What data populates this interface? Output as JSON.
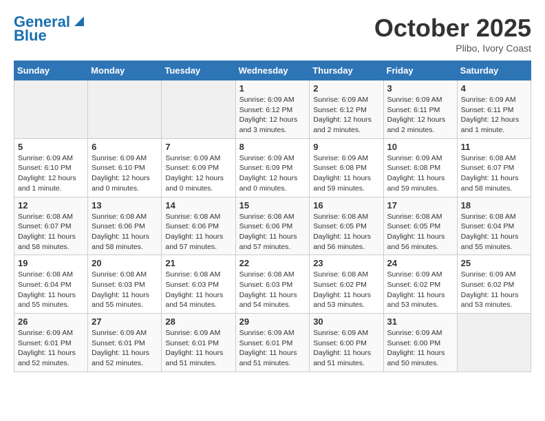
{
  "header": {
    "logo_line1": "General",
    "logo_line2": "Blue",
    "month": "October 2025",
    "location": "Plibo, Ivory Coast"
  },
  "weekdays": [
    "Sunday",
    "Monday",
    "Tuesday",
    "Wednesday",
    "Thursday",
    "Friday",
    "Saturday"
  ],
  "weeks": [
    [
      {
        "day": "",
        "info": ""
      },
      {
        "day": "",
        "info": ""
      },
      {
        "day": "",
        "info": ""
      },
      {
        "day": "1",
        "info": "Sunrise: 6:09 AM\nSunset: 6:12 PM\nDaylight: 12 hours and 3 minutes."
      },
      {
        "day": "2",
        "info": "Sunrise: 6:09 AM\nSunset: 6:12 PM\nDaylight: 12 hours and 2 minutes."
      },
      {
        "day": "3",
        "info": "Sunrise: 6:09 AM\nSunset: 6:11 PM\nDaylight: 12 hours and 2 minutes."
      },
      {
        "day": "4",
        "info": "Sunrise: 6:09 AM\nSunset: 6:11 PM\nDaylight: 12 hours and 1 minute."
      }
    ],
    [
      {
        "day": "5",
        "info": "Sunrise: 6:09 AM\nSunset: 6:10 PM\nDaylight: 12 hours and 1 minute."
      },
      {
        "day": "6",
        "info": "Sunrise: 6:09 AM\nSunset: 6:10 PM\nDaylight: 12 hours and 0 minutes."
      },
      {
        "day": "7",
        "info": "Sunrise: 6:09 AM\nSunset: 6:09 PM\nDaylight: 12 hours and 0 minutes."
      },
      {
        "day": "8",
        "info": "Sunrise: 6:09 AM\nSunset: 6:09 PM\nDaylight: 12 hours and 0 minutes."
      },
      {
        "day": "9",
        "info": "Sunrise: 6:09 AM\nSunset: 6:08 PM\nDaylight: 11 hours and 59 minutes."
      },
      {
        "day": "10",
        "info": "Sunrise: 6:09 AM\nSunset: 6:08 PM\nDaylight: 11 hours and 59 minutes."
      },
      {
        "day": "11",
        "info": "Sunrise: 6:08 AM\nSunset: 6:07 PM\nDaylight: 11 hours and 58 minutes."
      }
    ],
    [
      {
        "day": "12",
        "info": "Sunrise: 6:08 AM\nSunset: 6:07 PM\nDaylight: 11 hours and 58 minutes."
      },
      {
        "day": "13",
        "info": "Sunrise: 6:08 AM\nSunset: 6:06 PM\nDaylight: 11 hours and 58 minutes."
      },
      {
        "day": "14",
        "info": "Sunrise: 6:08 AM\nSunset: 6:06 PM\nDaylight: 11 hours and 57 minutes."
      },
      {
        "day": "15",
        "info": "Sunrise: 6:08 AM\nSunset: 6:06 PM\nDaylight: 11 hours and 57 minutes."
      },
      {
        "day": "16",
        "info": "Sunrise: 6:08 AM\nSunset: 6:05 PM\nDaylight: 11 hours and 56 minutes."
      },
      {
        "day": "17",
        "info": "Sunrise: 6:08 AM\nSunset: 6:05 PM\nDaylight: 11 hours and 56 minutes."
      },
      {
        "day": "18",
        "info": "Sunrise: 6:08 AM\nSunset: 6:04 PM\nDaylight: 11 hours and 55 minutes."
      }
    ],
    [
      {
        "day": "19",
        "info": "Sunrise: 6:08 AM\nSunset: 6:04 PM\nDaylight: 11 hours and 55 minutes."
      },
      {
        "day": "20",
        "info": "Sunrise: 6:08 AM\nSunset: 6:03 PM\nDaylight: 11 hours and 55 minutes."
      },
      {
        "day": "21",
        "info": "Sunrise: 6:08 AM\nSunset: 6:03 PM\nDaylight: 11 hours and 54 minutes."
      },
      {
        "day": "22",
        "info": "Sunrise: 6:08 AM\nSunset: 6:03 PM\nDaylight: 11 hours and 54 minutes."
      },
      {
        "day": "23",
        "info": "Sunrise: 6:08 AM\nSunset: 6:02 PM\nDaylight: 11 hours and 53 minutes."
      },
      {
        "day": "24",
        "info": "Sunrise: 6:09 AM\nSunset: 6:02 PM\nDaylight: 11 hours and 53 minutes."
      },
      {
        "day": "25",
        "info": "Sunrise: 6:09 AM\nSunset: 6:02 PM\nDaylight: 11 hours and 53 minutes."
      }
    ],
    [
      {
        "day": "26",
        "info": "Sunrise: 6:09 AM\nSunset: 6:01 PM\nDaylight: 11 hours and 52 minutes."
      },
      {
        "day": "27",
        "info": "Sunrise: 6:09 AM\nSunset: 6:01 PM\nDaylight: 11 hours and 52 minutes."
      },
      {
        "day": "28",
        "info": "Sunrise: 6:09 AM\nSunset: 6:01 PM\nDaylight: 11 hours and 51 minutes."
      },
      {
        "day": "29",
        "info": "Sunrise: 6:09 AM\nSunset: 6:01 PM\nDaylight: 11 hours and 51 minutes."
      },
      {
        "day": "30",
        "info": "Sunrise: 6:09 AM\nSunset: 6:00 PM\nDaylight: 11 hours and 51 minutes."
      },
      {
        "day": "31",
        "info": "Sunrise: 6:09 AM\nSunset: 6:00 PM\nDaylight: 11 hours and 50 minutes."
      },
      {
        "day": "",
        "info": ""
      }
    ]
  ]
}
